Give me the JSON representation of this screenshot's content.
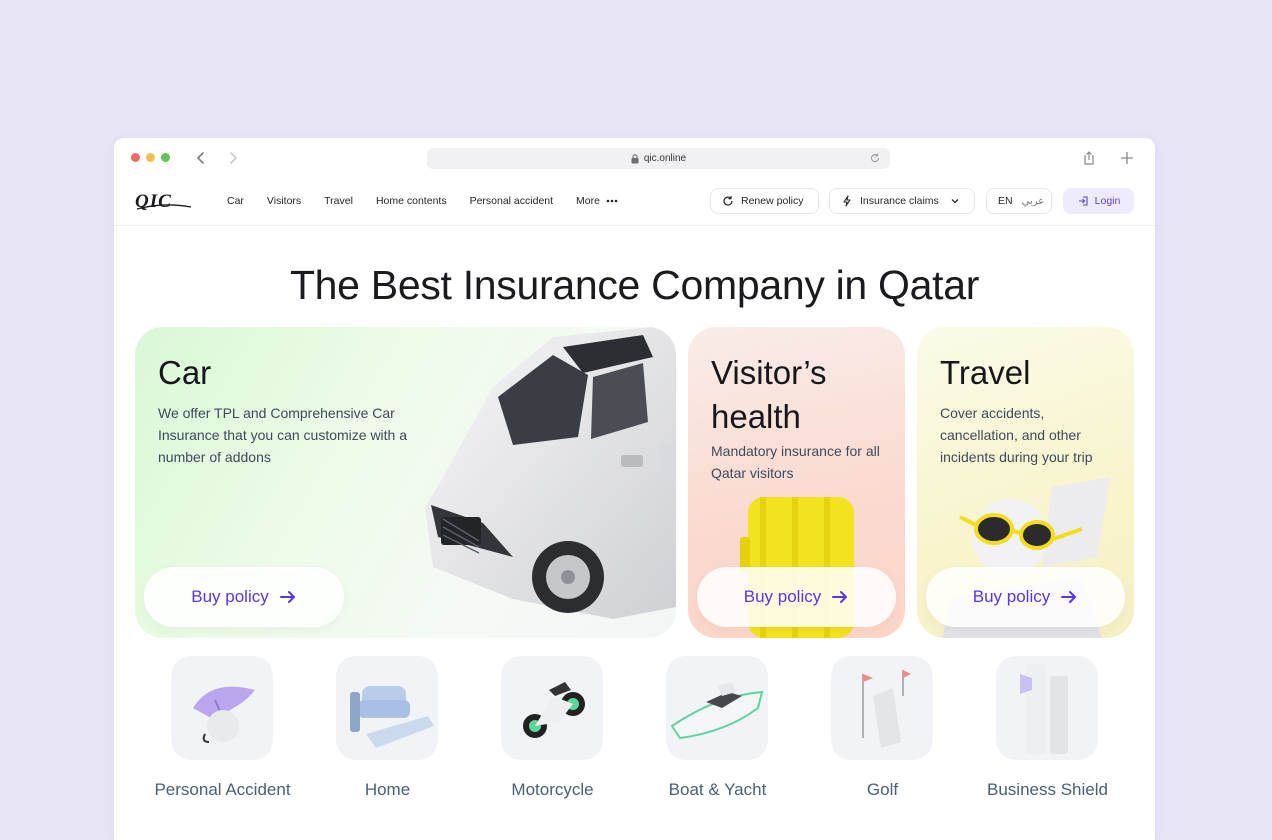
{
  "browser": {
    "url": "qic.online",
    "traffic_lights": [
      "#ed6a5e",
      "#f5bf4f",
      "#61c554"
    ]
  },
  "header": {
    "logo_text": "QIC",
    "nav": [
      "Car",
      "Visitors",
      "Travel",
      "Home contents",
      "Personal accident"
    ],
    "more_label": "More",
    "renew_label": "Renew policy",
    "claims_label": "Insurance claims",
    "lang_en": "EN",
    "lang_ar": "عربي",
    "login_label": "Login"
  },
  "hero": {
    "title": "The Best Insurance Company in Qatar"
  },
  "cards": {
    "car": {
      "title": "Car",
      "text": "We offer TPL and Comprehensive Car Insurance that you can customize with a number of addons",
      "cta": "Buy policy"
    },
    "visitor": {
      "title": "Visitor’s health",
      "text": "Mandatory insurance for all Qatar visitors",
      "cta": "Buy policy"
    },
    "travel": {
      "title": "Travel",
      "text": "Cover accidents, cancellation, and other incidents during your trip",
      "cta": "Buy policy"
    }
  },
  "categories": [
    {
      "label": "Personal Accident",
      "icon": "umbrella-icon"
    },
    {
      "label": "Home",
      "icon": "sofa-icon"
    },
    {
      "label": "Motorcycle",
      "icon": "motorcycle-icon"
    },
    {
      "label": "Boat & Yacht",
      "icon": "boat-icon"
    },
    {
      "label": "Golf",
      "icon": "golf-bag-icon"
    },
    {
      "label": "Business Shield",
      "icon": "business-shield-icon"
    }
  ],
  "colors": {
    "accent": "#5a34e8",
    "page_bg": "#e6e4f5",
    "category_text": "#4b5e78"
  }
}
